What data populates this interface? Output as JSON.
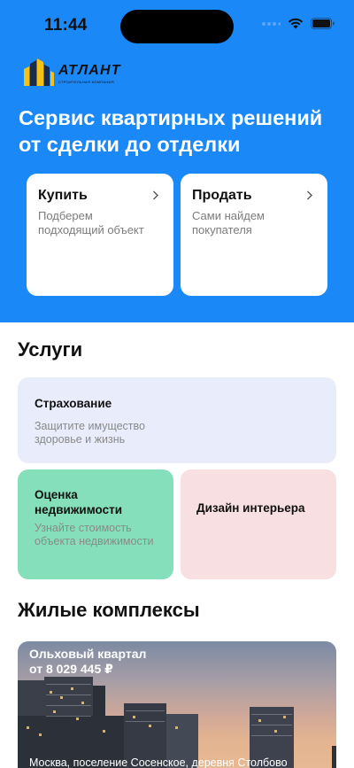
{
  "status_bar": {
    "time": "11:44",
    "icons": [
      "signal-dots-icon",
      "wifi-icon",
      "battery-icon"
    ]
  },
  "brand": {
    "name": "АТЛАНТ",
    "tagline": "СТРОИТЕЛЬНАЯ КОМПАНИЯ"
  },
  "hero": {
    "title": "Сервис квартирных решений от сделки до отделки",
    "background": "#1a88f7",
    "cards": [
      {
        "title": "Купить",
        "description": "Подберем подходящий объект",
        "icon": "chevron-right-icon"
      },
      {
        "title": "Продать",
        "description": "Сами найдем покупателя",
        "icon": "chevron-right-icon"
      }
    ]
  },
  "services": {
    "title": "Услуги",
    "items": [
      {
        "title": "Страхование",
        "description": "Защитите имущество здоровье и жизнь",
        "color": "#e8ecfb"
      },
      {
        "title": "Оценка недвижимости",
        "description": "Узнайте стоимость объекта недвижимости",
        "color": "#86dfbb"
      },
      {
        "title": "Дизайн интерьера",
        "description": "",
        "color": "#f8dfe2"
      }
    ]
  },
  "complexes": {
    "title": "Жилые комплексы",
    "items": [
      {
        "name": "Ольховый квартал",
        "price": "от 8 029 445 ₽",
        "address": "Москва, поселение Сосенское, деревня Столбово"
      }
    ]
  }
}
